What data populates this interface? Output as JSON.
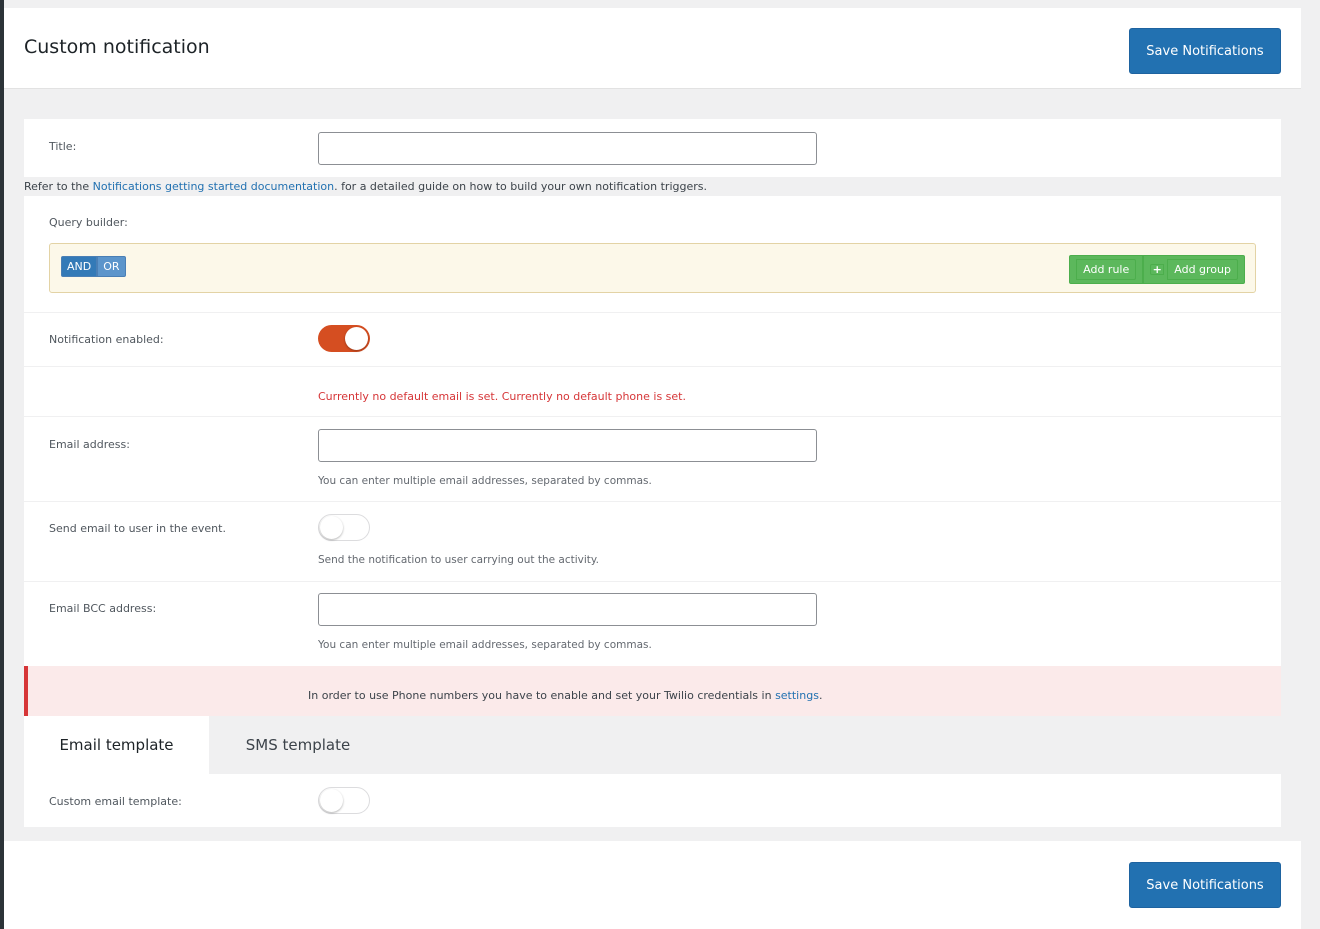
{
  "header": {
    "title": "Custom notification",
    "save_label": "Save Notifications"
  },
  "title_field": {
    "label": "Title:",
    "value": "",
    "placeholder": ""
  },
  "doc_line": {
    "prefix": "Refer to the ",
    "link_text": "Notifications getting started documentation",
    "suffix": ". for a detailed guide on how to build your own notification triggers."
  },
  "query_builder": {
    "label": "Query builder:",
    "and_label": "AND",
    "or_label": "OR",
    "add_rule_label": "Add rule",
    "add_group_label": "Add group"
  },
  "notification_enabled": {
    "label": "Notification enabled:",
    "enabled": true
  },
  "default_warning": "Currently no default email is set. Currently no default phone is set.",
  "email_address": {
    "label": "Email address:",
    "value": "",
    "hint": "You can enter multiple email addresses, separated by commas."
  },
  "send_to_user": {
    "label": "Send email to user in the event.",
    "enabled": false,
    "hint": "Send the notification to user carrying out the activity."
  },
  "email_bcc": {
    "label": "Email BCC address:",
    "value": "",
    "hint": "You can enter multiple email addresses, separated by commas."
  },
  "twilio_notice": {
    "text": "In order to use Phone numbers you have to enable and set your Twilio credentials in ",
    "link_text": "settings",
    "suffix": "."
  },
  "tabs": [
    {
      "label": "Email template",
      "active": true
    },
    {
      "label": "SMS template",
      "active": false
    }
  ],
  "custom_template": {
    "label": "Custom email template:",
    "enabled": false
  },
  "footer": {
    "save_label": "Save Notifications"
  },
  "colors": {
    "primary": "#2271b1",
    "toggle_on": "#d54e21",
    "error": "#d63638",
    "success": "#5cb85c"
  }
}
